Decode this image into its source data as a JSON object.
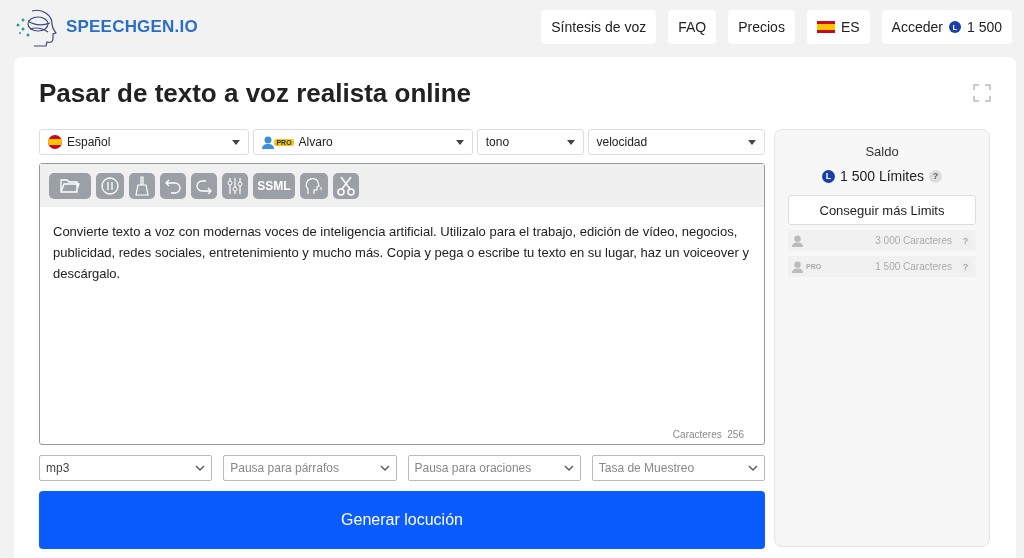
{
  "header": {
    "logo": "SPEECHGEN.IO",
    "nav": [
      {
        "label": "Síntesis de voz",
        "kind": "link"
      },
      {
        "label": "FAQ",
        "kind": "link"
      },
      {
        "label": "Precios",
        "kind": "link"
      },
      {
        "label": "ES",
        "kind": "lang"
      },
      {
        "label": "Acceder",
        "kind": "login",
        "coin": "L",
        "amount": "1 500"
      }
    ]
  },
  "title": "Pasar de texto a voz realista online",
  "selects": [
    {
      "value": "Español",
      "kind": "lang"
    },
    {
      "value": "Alvaro",
      "kind": "voice",
      "badge": "PRO"
    },
    {
      "value": "tono",
      "kind": "plain"
    },
    {
      "value": "velocidad",
      "kind": "plain"
    }
  ],
  "toolbar": {
    "ssml_label": "SSML"
  },
  "text": "Convierte texto a voz con modernas voces de inteligencia artificial. Utilizalo para el trabajo, edición de vídeo, negocios, publicidad, redes sociales, entretenimiento y mucho más. Copia y pega o escribe tu texto en su lugar, haz un voiceover y descárgalo.",
  "counter": {
    "label": "Caracteres",
    "value": "256"
  },
  "options": [
    {
      "value": "mp3",
      "placeholder": false
    },
    {
      "value": "Pausa para párrafos",
      "placeholder": true
    },
    {
      "value": "Pausa para oraciones",
      "placeholder": true
    },
    {
      "value": "Tasa de Muestreo",
      "placeholder": true
    }
  ],
  "generate_button": "Generar locución",
  "balance": {
    "title": "Saldo",
    "coin": "L",
    "amount": "1 500 Límites",
    "help": "?",
    "button": "Conseguir más Limits",
    "tiers": [
      {
        "text": "3 000 Caracteres",
        "help": "?"
      },
      {
        "badge": "PRO",
        "text": "1 500 Caracteres",
        "help": "?"
      }
    ]
  }
}
